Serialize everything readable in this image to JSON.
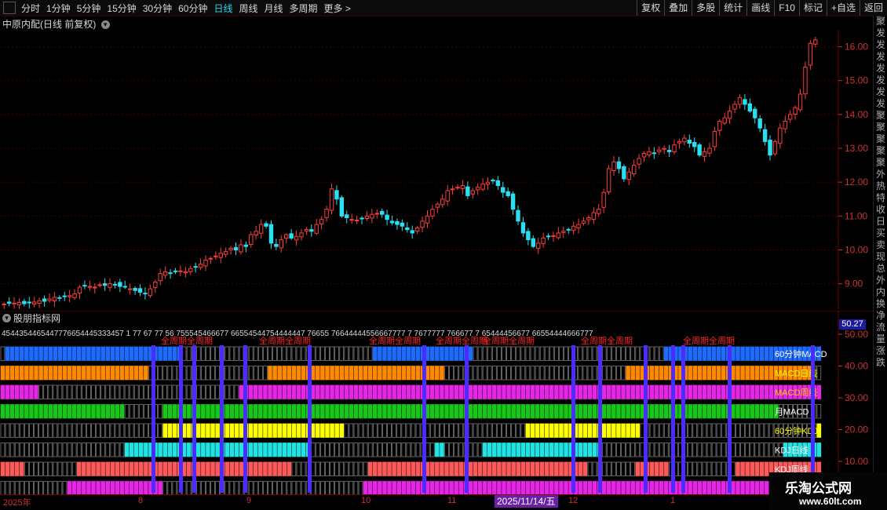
{
  "toolbar": {
    "periods": [
      "分时",
      "1分钟",
      "5分钟",
      "15分钟",
      "30分钟",
      "60分钟",
      "日线",
      "周线",
      "月线",
      "多周期",
      "更多"
    ],
    "active_period": "日线",
    "more_arrow": ">",
    "right_buttons": [
      "复权",
      "叠加",
      "多股",
      "统计",
      "画线",
      "F10",
      "标记",
      "+自选",
      "返回"
    ]
  },
  "stock_title": "中原内配(日线 前复权)",
  "indicator": {
    "title": "股朋指标网",
    "current_value": "50.27",
    "row_labels": [
      "60分钟MACD",
      "MACD日线",
      "MACD周线",
      "月MACD",
      "60分钟KDJ",
      "KDJ日线",
      "KDJ周线",
      "KDJ月线"
    ],
    "row_colors": [
      "#1e6cff",
      "#ff8a00",
      "#e626e6",
      "#18c818",
      "#ffff00",
      "#22e3e3",
      "#ff5a5a",
      "#e626e6"
    ],
    "top_digits": "4544354465447776654445333457 1 77 67 77 56 755545466677 66554544754444447 76655 76644444556667777 7 7677777 766677 7 65444456677 66554444666777",
    "top_marker": "全周期",
    "y_ticks": [
      "50.00",
      "40.00",
      "30.00",
      "20.00",
      "10.00"
    ]
  },
  "price_axis": {
    "ticks": [
      "16.00",
      "15.00",
      "14.00",
      "13.00",
      "12.00",
      "11.00",
      "10.00",
      "9.00"
    ]
  },
  "chart_data": {
    "type": "candlestick",
    "title": "中原内配(日线 前复权)",
    "y_range": [
      8.25,
      16.5
    ],
    "closes_approx": [
      8.4,
      8.42,
      8.43,
      8.45,
      8.41,
      8.44,
      8.46,
      8.5,
      8.48,
      8.55,
      8.6,
      8.58,
      8.62,
      8.65,
      8.7,
      8.9,
      8.95,
      8.92,
      8.9,
      8.97,
      8.95,
      9.0,
      8.98,
      8.92,
      8.9,
      8.85,
      8.8,
      8.75,
      8.7,
      8.85,
      9.05,
      9.3,
      9.35,
      9.32,
      9.36,
      9.38,
      9.35,
      9.45,
      9.5,
      9.58,
      9.7,
      9.75,
      9.82,
      9.9,
      9.95,
      10.05,
      10.0,
      10.15,
      10.1,
      10.45,
      10.55,
      10.75,
      10.7,
      10.2,
      10.1,
      10.3,
      10.45,
      10.35,
      10.4,
      10.5,
      10.6,
      10.55,
      10.75,
      10.9,
      11.2,
      11.8,
      11.5,
      11.0,
      10.95,
      10.9,
      10.88,
      10.92,
      11.0,
      11.05,
      11.08,
      11.05,
      10.9,
      10.8,
      10.75,
      10.7,
      10.6,
      10.5,
      10.65,
      10.85,
      11.0,
      11.2,
      11.35,
      11.5,
      11.75,
      11.8,
      11.85,
      11.9,
      11.6,
      11.75,
      11.85,
      11.95,
      12.0,
      12.05,
      11.9,
      11.7,
      11.6,
      11.2,
      10.85,
      10.5,
      10.3,
      10.1,
      10.2,
      10.35,
      10.4,
      10.42,
      10.5,
      10.55,
      10.6,
      10.7,
      10.75,
      10.85,
      10.95,
      11.1,
      11.2,
      11.7,
      12.4,
      12.6,
      12.4,
      12.1,
      12.3,
      12.5,
      12.7,
      12.85,
      12.9,
      12.85,
      12.95,
      13.0,
      12.9,
      13.1,
      13.2,
      13.3,
      13.15,
      13.05,
      12.8,
      12.9,
      13.0,
      13.5,
      13.8,
      13.9,
      14.1,
      14.3,
      14.5,
      14.3,
      14.1,
      13.9,
      13.6,
      13.2,
      12.8,
      13.2,
      13.6,
      13.8,
      14.0,
      14.2,
      14.6,
      15.4,
      16.1,
      16.2
    ]
  },
  "date_axis": {
    "labels": [
      "2025年",
      "8",
      "9",
      "10",
      "11",
      "12",
      "1"
    ],
    "cursor_date": "2025/11/14/五"
  },
  "right_strip": {
    "chars": [
      "聚",
      "发",
      "发",
      "发",
      "发",
      "发",
      "发",
      "发",
      "聚",
      "聚",
      "聚",
      "聚",
      "聚",
      "外",
      "热",
      "特",
      "收",
      "日",
      "买",
      "卖",
      "现",
      "总",
      "外",
      "内",
      "换",
      "净",
      "流",
      "量",
      "涨",
      "跌"
    ]
  },
  "watermark": {
    "line1": "乐淘公式网",
    "line2": "www.60lt.com"
  }
}
